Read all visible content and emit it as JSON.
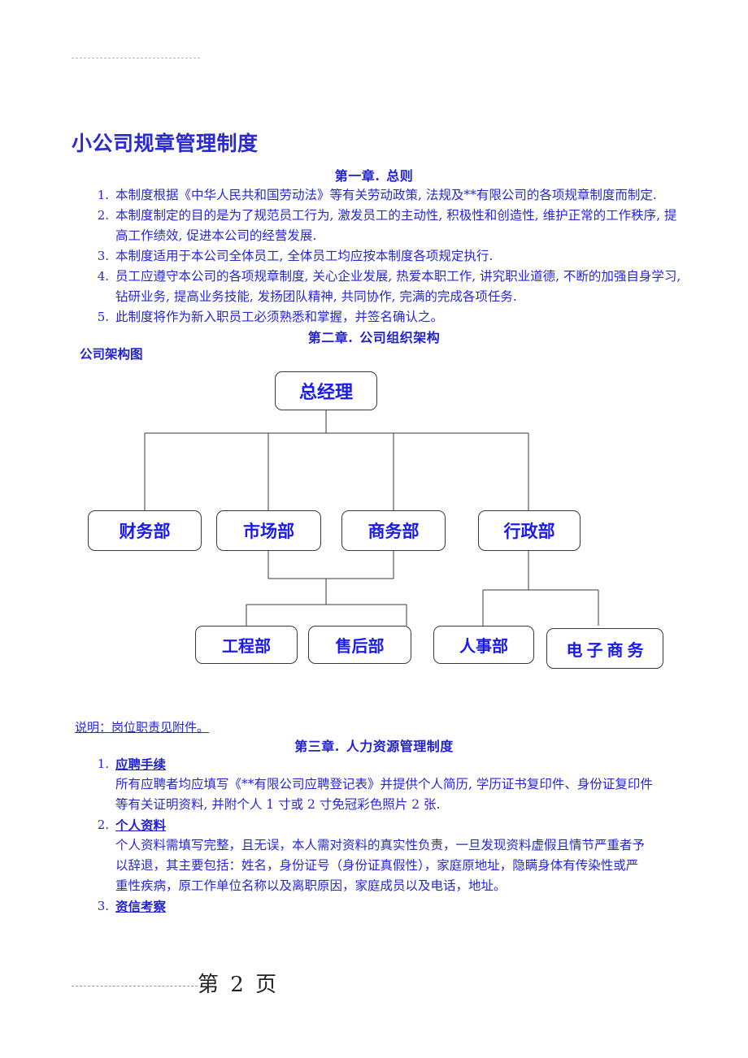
{
  "document": {
    "title": "小公司规章管理制度",
    "page_footer": "第 2 页"
  },
  "chapters": [
    {
      "id": "ch1",
      "number": "第一章.",
      "name": "总则"
    },
    {
      "id": "ch2",
      "number": "第二章.",
      "name": "公司组织架构"
    },
    {
      "id": "ch3",
      "number": "第三章.",
      "name": "人力资源管理制度"
    }
  ],
  "chapter1_items": [
    {
      "num": "1.",
      "text": "本制度根据《中华人民共和国劳动法》等有关劳动政策, 法规及**有限公司的各项规章制度而制定."
    },
    {
      "num": "2.",
      "text": "本制度制定的目的是为了规范员工行为, 激发员工的主动性, 积极性和创造性, 维护正常的工作秩序, 提高工作绩效, 促进本公司的经营发展."
    },
    {
      "num": "3.",
      "text": "本制度适用于本公司全体员工, 全体员工均应按本制度各项规定执行."
    },
    {
      "num": "4.",
      "text": "员工应遵守本公司的各项规章制度, 关心企业发展, 热爱本职工作, 讲究职业道德, 不断的加强自身学习, 钻研业务, 提高业务技能, 发扬团队精神, 共同协作, 完满的完成各项任务."
    },
    {
      "num": "5.",
      "text": "此制度将作为新入职员工必须熟悉和掌握，并签名确认之。"
    }
  ],
  "chapter2": {
    "section_label": "公司架构图",
    "note": "说明：岗位职责见附件。"
  },
  "org_chart": {
    "root": {
      "id": "gm",
      "label": "总经理"
    },
    "level2": [
      {
        "id": "finance",
        "label": "财务部"
      },
      {
        "id": "marketing",
        "label": "市场部"
      },
      {
        "id": "business",
        "label": "商务部"
      },
      {
        "id": "admin",
        "label": "行政部"
      }
    ],
    "level3": [
      {
        "id": "engineering",
        "label": "工程部",
        "parents": [
          "marketing",
          "business"
        ]
      },
      {
        "id": "aftersales",
        "label": "售后部",
        "parents": [
          "marketing",
          "business"
        ]
      },
      {
        "id": "hr",
        "label": "人事部",
        "parents": [
          "admin"
        ]
      },
      {
        "id": "ecommerce",
        "label": "电子商务",
        "parents": [
          "admin"
        ],
        "letter_spaced": true
      }
    ]
  },
  "chapter3_items": [
    {
      "num": "1.",
      "heading": "应聘手续",
      "lines": [
        "所有应聘者均应填写《**有限公司应聘登记表》并提供个人简历, 学历证书复印件、身份证复印件",
        "等有关证明资料, 并附个人 1 寸或 2 寸免冠彩色照片 2 张."
      ]
    },
    {
      "num": "2.",
      "heading": "个人资料",
      "lines": [
        "个人资料需填写完整，且无误，本人需对资料的真实性负责，一旦发现资料虚假且情节严重者予",
        "以辞退，其主要包括：姓名，身份证号（身份证真假性），家庭原地址，隐瞒身体有传染性或严",
        "重性疾病，原工作单位名称以及离职原因，家庭成员以及电话，地址。"
      ]
    },
    {
      "num": "3.",
      "heading": "资信考察",
      "lines": []
    }
  ],
  "colors": {
    "text_blue": "#2727cf",
    "heading_blue": "#2222cc",
    "node_text_blue": "#1a1aee",
    "node_border": "#3a3a3a",
    "rule_gray": "#b8b8b8"
  }
}
